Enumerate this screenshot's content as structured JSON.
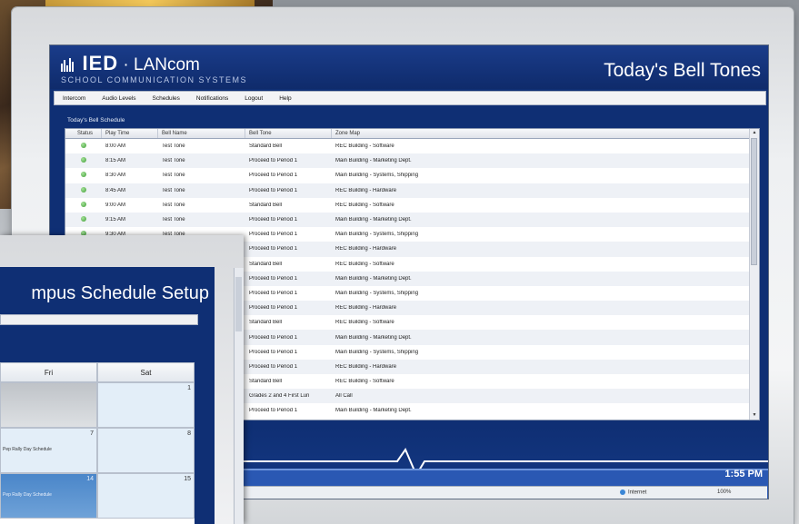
{
  "app": {
    "logo_main": "IED",
    "logo_dot": "·",
    "logo_product": "LANcom",
    "logo_tagline": "SCHOOL COMMUNICATION SYSTEMS",
    "page_title": "Today's Bell Tones"
  },
  "menu": {
    "items": [
      "Intercom",
      "Audio Levels",
      "Schedules",
      "Notifications",
      "Logout",
      "Help"
    ]
  },
  "schedule": {
    "section_label": "Today's Bell Schedule",
    "columns": [
      "Status",
      "Play Time",
      "Bell Name",
      "Bell Tone",
      "Zone Map"
    ],
    "rows": [
      {
        "status": "active",
        "time": "8:00 AM",
        "name": "Test Tone",
        "tone": "Standard Bell",
        "zone": "REC Building - Software"
      },
      {
        "status": "active",
        "time": "8:15 AM",
        "name": "Test Tone",
        "tone": "Proceed to Period 1",
        "zone": "Main Building - Marketing Dept."
      },
      {
        "status": "active",
        "time": "8:30 AM",
        "name": "Test Tone",
        "tone": "Proceed to Period 1",
        "zone": "Main Building - Systems, Shipping"
      },
      {
        "status": "active",
        "time": "8:45 AM",
        "name": "Test Tone",
        "tone": "Proceed to Period 1",
        "zone": "REC Building - Hardware"
      },
      {
        "status": "active",
        "time": "9:00 AM",
        "name": "Test Tone",
        "tone": "Standard Bell",
        "zone": "REC Building - Software"
      },
      {
        "status": "active",
        "time": "9:15 AM",
        "name": "Test Tone",
        "tone": "Proceed to Period 1",
        "zone": "Main Building - Marketing Dept."
      },
      {
        "status": "active",
        "time": "9:30 AM",
        "name": "Test Tone",
        "tone": "Proceed to Period 1",
        "zone": "Main Building - Systems, Shipping"
      },
      {
        "status": "",
        "time": "",
        "name": "",
        "tone": "Proceed to Period 1",
        "zone": "REC Building - Hardware"
      },
      {
        "status": "",
        "time": "",
        "name": "",
        "tone": "Standard Bell",
        "zone": "REC Building - Software"
      },
      {
        "status": "",
        "time": "",
        "name": "",
        "tone": "Proceed to Period 1",
        "zone": "Main Building - Marketing Dept."
      },
      {
        "status": "",
        "time": "",
        "name": "",
        "tone": "Proceed to Period 1",
        "zone": "Main Building - Systems, Shipping"
      },
      {
        "status": "",
        "time": "",
        "name": "",
        "tone": "Proceed to Period 1",
        "zone": "REC Building - Hardware"
      },
      {
        "status": "",
        "time": "",
        "name": "",
        "tone": "Standard Bell",
        "zone": "REC Building - Software"
      },
      {
        "status": "",
        "time": "",
        "name": "",
        "tone": "Proceed to Period 1",
        "zone": "Main Building - Marketing Dept."
      },
      {
        "status": "",
        "time": "",
        "name": "",
        "tone": "Proceed to Period 1",
        "zone": "Main Building - Systems, Shipping"
      },
      {
        "status": "",
        "time": "",
        "name": "",
        "tone": "Proceed to Period 1",
        "zone": "REC Building - Hardware"
      },
      {
        "status": "",
        "time": "",
        "name": "",
        "tone": "Standard Bell",
        "zone": "REC Building - Software"
      },
      {
        "status": "",
        "time": "",
        "name": "",
        "tone": "Grades 2 and 4 First Lun",
        "zone": "All Call"
      },
      {
        "status": "",
        "time": "",
        "name": "",
        "tone": "Proceed to Period 1",
        "zone": "Main Building - Marketing Dept."
      }
    ]
  },
  "clock": "1:55 PM",
  "statusbar": {
    "zone": "Internet",
    "zoom": "100%"
  },
  "second_window": {
    "title": "mpus Schedule Setup",
    "days": [
      "Fri",
      "Sat"
    ],
    "weeks": [
      [
        {
          "num": "",
          "event": ""
        },
        {
          "num": "1",
          "event": ""
        }
      ],
      [
        {
          "num": "7",
          "event": "Pep Rally Day Schedule"
        },
        {
          "num": "8",
          "event": ""
        }
      ],
      [
        {
          "num": "14",
          "event": "Pep Rally Day Schedule"
        },
        {
          "num": "15",
          "event": ""
        }
      ]
    ]
  },
  "colors": {
    "brand_navy": "#0f2f74",
    "status_ok": "#3e9d35"
  }
}
